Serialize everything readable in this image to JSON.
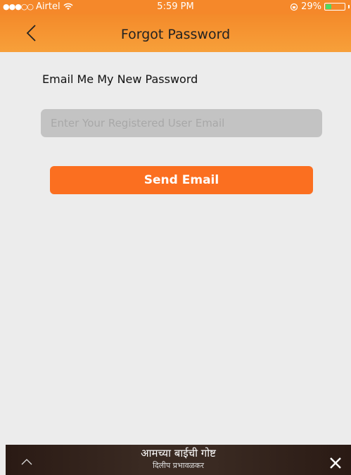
{
  "status_bar": {
    "signal": "●●●○○",
    "carrier": "Airtel",
    "time": "5:59 PM",
    "battery_percent": "29%",
    "battery_level": 0.29
  },
  "nav": {
    "title": "Forgot Password",
    "back_icon": "chevron-left-icon"
  },
  "form": {
    "label": "Email Me My New Password",
    "email_placeholder": "Enter Your Registered User Email",
    "email_value": "",
    "send_label": "Send Email"
  },
  "bottom_bar": {
    "title": "आमच्या बाईची गोष्ट",
    "subtitle": "दिलीप प्रभावळकर",
    "expand_icon": "chevron-up-icon",
    "close_icon": "close-icon"
  },
  "colors": {
    "accent": "#f5882a",
    "button": "#fb6f20",
    "background": "#ececec",
    "input_bg": "#c3c3c3"
  }
}
